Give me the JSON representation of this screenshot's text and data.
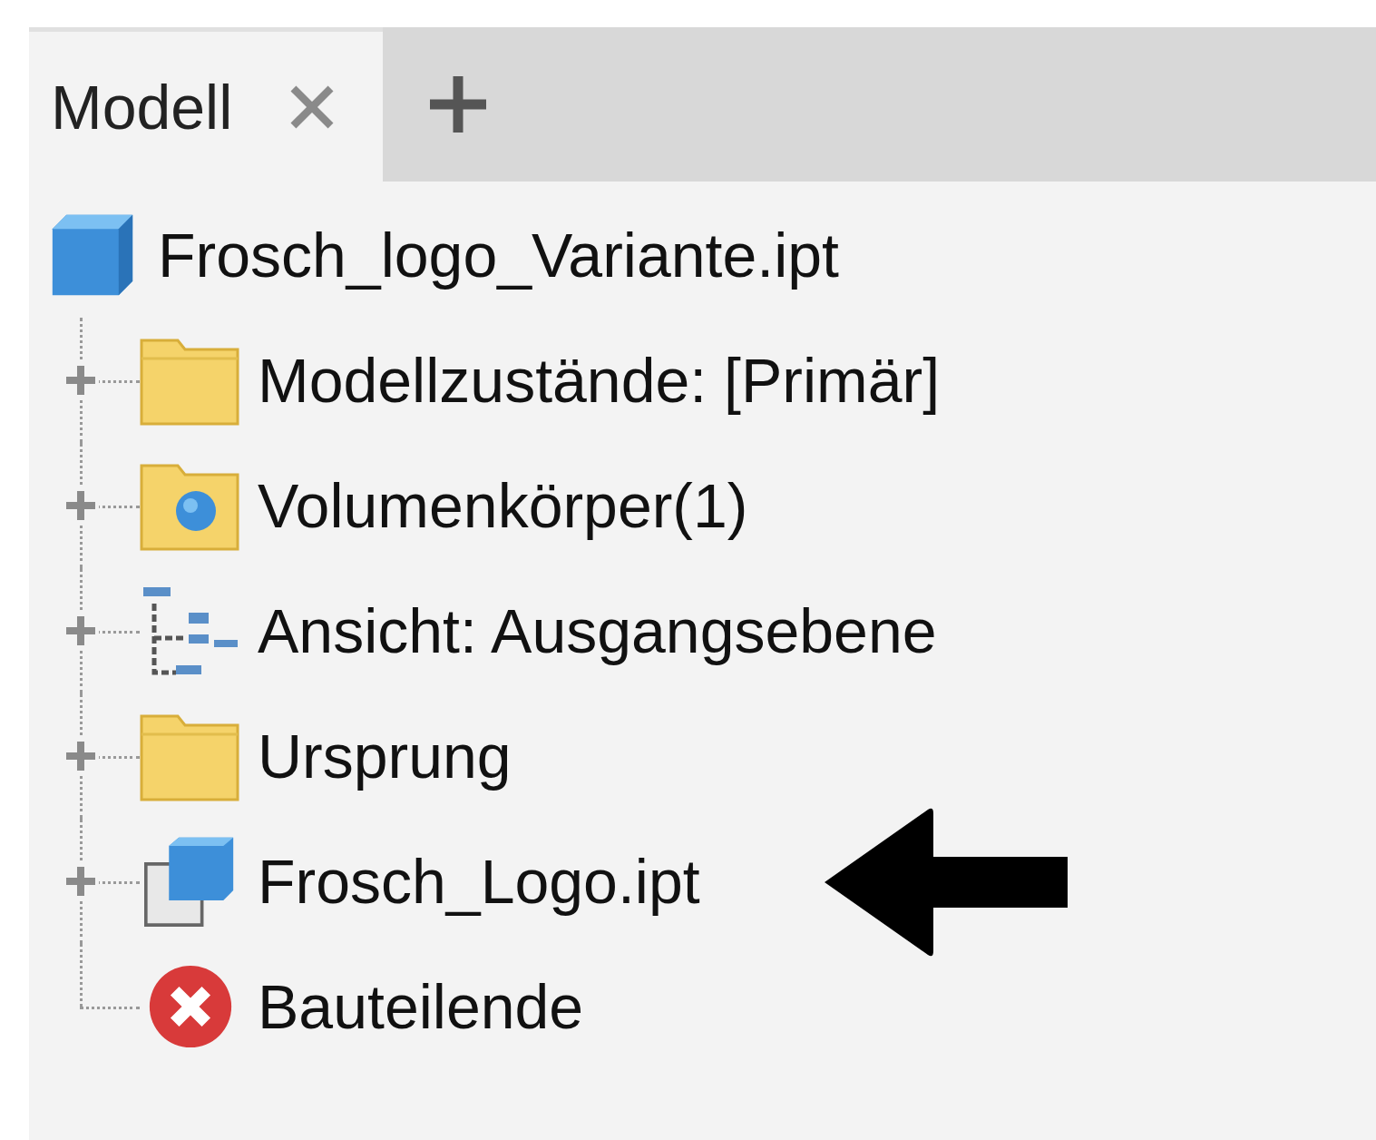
{
  "tabs": [
    {
      "label": "Modell",
      "selected": true
    }
  ],
  "tree": {
    "label": "Frosch_logo_Variante.ipt",
    "kind": "part",
    "children": [
      {
        "label": "Modellzustände: [Primär]",
        "kind": "folder",
        "expanded": false
      },
      {
        "label": "Volumenkörper(1)",
        "kind": "solids",
        "expanded": false
      },
      {
        "label": "Ansicht: Ausgangsebene",
        "kind": "view",
        "expanded": false
      },
      {
        "label": "Ursprung",
        "kind": "folder",
        "expanded": false
      },
      {
        "label": "Frosch_Logo.ipt",
        "kind": "derived",
        "expanded": false
      },
      {
        "label": "Bauteilende",
        "kind": "end"
      }
    ]
  }
}
